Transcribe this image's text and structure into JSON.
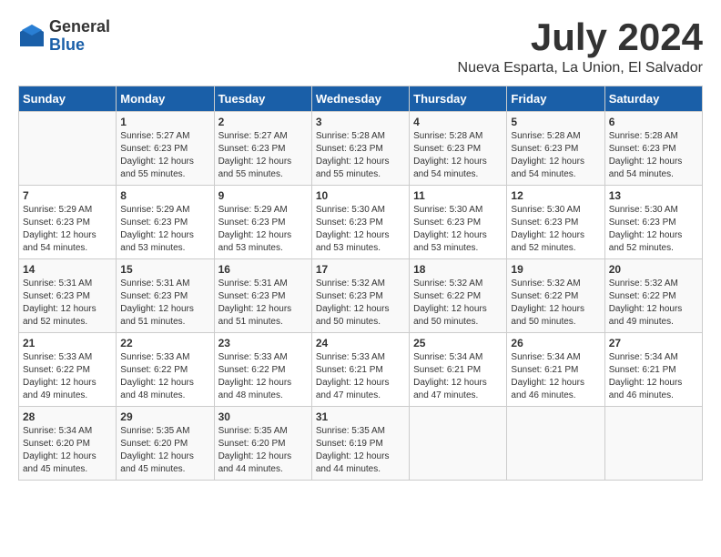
{
  "header": {
    "logo_general": "General",
    "logo_blue": "Blue",
    "month_title": "July 2024",
    "location": "Nueva Esparta, La Union, El Salvador"
  },
  "calendar": {
    "days_of_week": [
      "Sunday",
      "Monday",
      "Tuesday",
      "Wednesday",
      "Thursday",
      "Friday",
      "Saturday"
    ],
    "weeks": [
      [
        {
          "day": "",
          "info": ""
        },
        {
          "day": "1",
          "info": "Sunrise: 5:27 AM\nSunset: 6:23 PM\nDaylight: 12 hours\nand 55 minutes."
        },
        {
          "day": "2",
          "info": "Sunrise: 5:27 AM\nSunset: 6:23 PM\nDaylight: 12 hours\nand 55 minutes."
        },
        {
          "day": "3",
          "info": "Sunrise: 5:28 AM\nSunset: 6:23 PM\nDaylight: 12 hours\nand 55 minutes."
        },
        {
          "day": "4",
          "info": "Sunrise: 5:28 AM\nSunset: 6:23 PM\nDaylight: 12 hours\nand 54 minutes."
        },
        {
          "day": "5",
          "info": "Sunrise: 5:28 AM\nSunset: 6:23 PM\nDaylight: 12 hours\nand 54 minutes."
        },
        {
          "day": "6",
          "info": "Sunrise: 5:28 AM\nSunset: 6:23 PM\nDaylight: 12 hours\nand 54 minutes."
        }
      ],
      [
        {
          "day": "7",
          "info": "Sunrise: 5:29 AM\nSunset: 6:23 PM\nDaylight: 12 hours\nand 54 minutes."
        },
        {
          "day": "8",
          "info": "Sunrise: 5:29 AM\nSunset: 6:23 PM\nDaylight: 12 hours\nand 53 minutes."
        },
        {
          "day": "9",
          "info": "Sunrise: 5:29 AM\nSunset: 6:23 PM\nDaylight: 12 hours\nand 53 minutes."
        },
        {
          "day": "10",
          "info": "Sunrise: 5:30 AM\nSunset: 6:23 PM\nDaylight: 12 hours\nand 53 minutes."
        },
        {
          "day": "11",
          "info": "Sunrise: 5:30 AM\nSunset: 6:23 PM\nDaylight: 12 hours\nand 53 minutes."
        },
        {
          "day": "12",
          "info": "Sunrise: 5:30 AM\nSunset: 6:23 PM\nDaylight: 12 hours\nand 52 minutes."
        },
        {
          "day": "13",
          "info": "Sunrise: 5:30 AM\nSunset: 6:23 PM\nDaylight: 12 hours\nand 52 minutes."
        }
      ],
      [
        {
          "day": "14",
          "info": "Sunrise: 5:31 AM\nSunset: 6:23 PM\nDaylight: 12 hours\nand 52 minutes."
        },
        {
          "day": "15",
          "info": "Sunrise: 5:31 AM\nSunset: 6:23 PM\nDaylight: 12 hours\nand 51 minutes."
        },
        {
          "day": "16",
          "info": "Sunrise: 5:31 AM\nSunset: 6:23 PM\nDaylight: 12 hours\nand 51 minutes."
        },
        {
          "day": "17",
          "info": "Sunrise: 5:32 AM\nSunset: 6:23 PM\nDaylight: 12 hours\nand 50 minutes."
        },
        {
          "day": "18",
          "info": "Sunrise: 5:32 AM\nSunset: 6:22 PM\nDaylight: 12 hours\nand 50 minutes."
        },
        {
          "day": "19",
          "info": "Sunrise: 5:32 AM\nSunset: 6:22 PM\nDaylight: 12 hours\nand 50 minutes."
        },
        {
          "day": "20",
          "info": "Sunrise: 5:32 AM\nSunset: 6:22 PM\nDaylight: 12 hours\nand 49 minutes."
        }
      ],
      [
        {
          "day": "21",
          "info": "Sunrise: 5:33 AM\nSunset: 6:22 PM\nDaylight: 12 hours\nand 49 minutes."
        },
        {
          "day": "22",
          "info": "Sunrise: 5:33 AM\nSunset: 6:22 PM\nDaylight: 12 hours\nand 48 minutes."
        },
        {
          "day": "23",
          "info": "Sunrise: 5:33 AM\nSunset: 6:22 PM\nDaylight: 12 hours\nand 48 minutes."
        },
        {
          "day": "24",
          "info": "Sunrise: 5:33 AM\nSunset: 6:21 PM\nDaylight: 12 hours\nand 47 minutes."
        },
        {
          "day": "25",
          "info": "Sunrise: 5:34 AM\nSunset: 6:21 PM\nDaylight: 12 hours\nand 47 minutes."
        },
        {
          "day": "26",
          "info": "Sunrise: 5:34 AM\nSunset: 6:21 PM\nDaylight: 12 hours\nand 46 minutes."
        },
        {
          "day": "27",
          "info": "Sunrise: 5:34 AM\nSunset: 6:21 PM\nDaylight: 12 hours\nand 46 minutes."
        }
      ],
      [
        {
          "day": "28",
          "info": "Sunrise: 5:34 AM\nSunset: 6:20 PM\nDaylight: 12 hours\nand 45 minutes."
        },
        {
          "day": "29",
          "info": "Sunrise: 5:35 AM\nSunset: 6:20 PM\nDaylight: 12 hours\nand 45 minutes."
        },
        {
          "day": "30",
          "info": "Sunrise: 5:35 AM\nSunset: 6:20 PM\nDaylight: 12 hours\nand 44 minutes."
        },
        {
          "day": "31",
          "info": "Sunrise: 5:35 AM\nSunset: 6:19 PM\nDaylight: 12 hours\nand 44 minutes."
        },
        {
          "day": "",
          "info": ""
        },
        {
          "day": "",
          "info": ""
        },
        {
          "day": "",
          "info": ""
        }
      ]
    ]
  }
}
